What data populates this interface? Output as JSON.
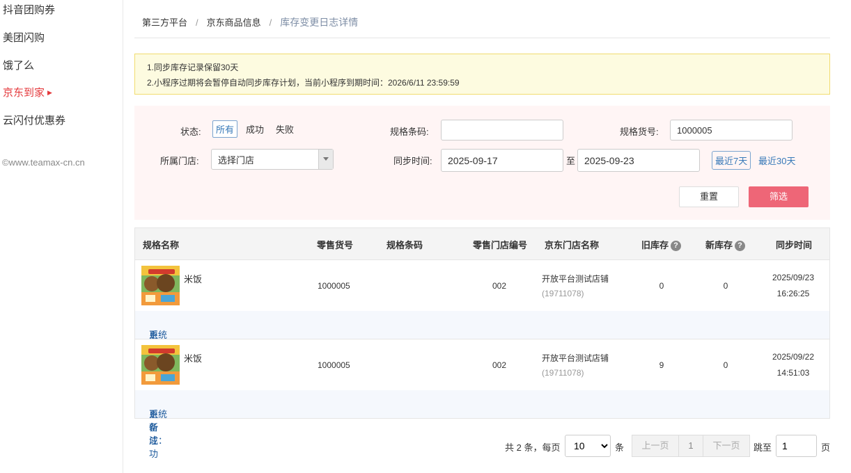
{
  "sidebar": {
    "items": [
      {
        "label": "抖音团购券"
      },
      {
        "label": "美团闪购"
      },
      {
        "label": "饿了么"
      },
      {
        "label": "京东到家"
      },
      {
        "label": "云闪付优惠券"
      }
    ],
    "active_index": 3,
    "copyright": "©www.teamax-cn.cn"
  },
  "breadcrumb": {
    "items": [
      "第三方平台",
      "京东商品信息"
    ],
    "current": "库存变更日志详情",
    "separator": "/"
  },
  "notice": {
    "lines": [
      "1.同步库存记录保留30天",
      "2.小程序过期将会暂停自动同步库存计划，当前小程序到期时间：2026/6/11 23:59:59"
    ]
  },
  "filters": {
    "status_label": "状态:",
    "status_options": [
      "所有",
      "成功",
      "失败"
    ],
    "status_selected": "所有",
    "barcode_label": "规格条码:",
    "barcode_value": "",
    "sku_label": "规格货号:",
    "sku_value": "1000005",
    "store_label": "所属门店:",
    "store_value": "选择门店",
    "sync_time_label": "同步时间:",
    "date_from": "2025-09-17",
    "date_to_sep": "至",
    "date_to": "2025-09-23",
    "quick_7": "最近7天",
    "quick_30": "最近30天",
    "reset_label": "重置",
    "filter_label": "筛选"
  },
  "table": {
    "columns": [
      "规格名称",
      "零售货号",
      "规格条码",
      "零售门店编号",
      "京东门店名称",
      "旧库存",
      "新库存",
      "同步时间"
    ],
    "rows": [
      {
        "name": "米饭",
        "sku": "1000005",
        "barcode": "",
        "store_no": "002",
        "store_name": "开放平台测试店铺",
        "store_id": "(19711078)",
        "old_stock": "0",
        "new_stock": "0",
        "sync_date": "2025/09/23",
        "sync_time": "16:26:25",
        "remark_label": "系统备注：",
        "remark": "更新成功"
      },
      {
        "name": "米饭",
        "sku": "1000005",
        "barcode": "",
        "store_no": "002",
        "store_name": "开放平台测试店铺",
        "store_id": "(19711078)",
        "old_stock": "9",
        "new_stock": "0",
        "sync_date": "2025/09/22",
        "sync_time": "14:51:03",
        "remark_label": "系统备注：",
        "remark": "更新成功"
      }
    ]
  },
  "pagination": {
    "total_text": "共 2 条，每页",
    "page_size": "10",
    "unit": "条",
    "prev": "上一页",
    "current_page": "1",
    "next": "下一页",
    "jump_label": "跳至",
    "jump_value": "1",
    "page_unit": "页"
  },
  "colors": {
    "accent_red": "#e4393c",
    "link_blue": "#3779b8",
    "filter_button": "#ee6677",
    "notice_bg": "#fdfbe0"
  }
}
